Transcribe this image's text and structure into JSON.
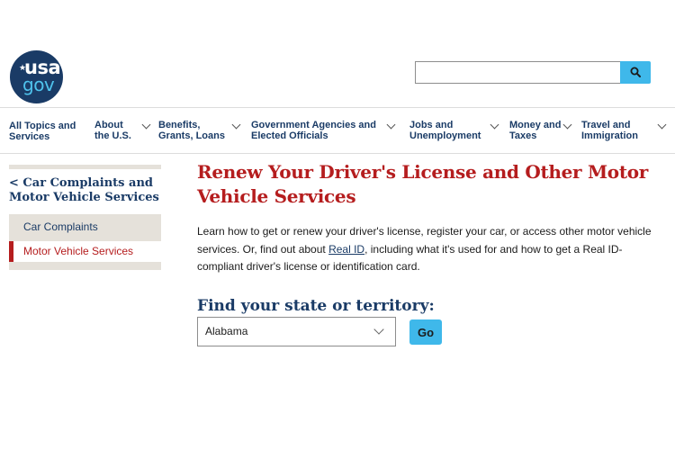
{
  "header": {
    "logo": {
      "line1": "usa",
      "line2": "gov",
      "star": "★"
    },
    "search": {
      "value": "",
      "placeholder": "",
      "button_icon": "search-icon"
    }
  },
  "nav": {
    "items": [
      {
        "label": "All Topics and\nServices",
        "has_dropdown": false
      },
      {
        "label": "About\nthe U.S.",
        "has_dropdown": true
      },
      {
        "label": "Benefits,\nGrants, Loans",
        "has_dropdown": true
      },
      {
        "label": "Government Agencies and\nElected Officials",
        "has_dropdown": true
      },
      {
        "label": "Jobs and\nUnemployment",
        "has_dropdown": true
      },
      {
        "label": "Money and\nTaxes",
        "has_dropdown": true
      },
      {
        "label": "Travel and\nImmigration",
        "has_dropdown": true
      }
    ]
  },
  "sidenav": {
    "parent": "< Car Complaints and Motor Vehicle Services",
    "items": [
      {
        "label": "Car Complaints",
        "active": false
      },
      {
        "label": "Motor Vehicle Services",
        "active": true
      }
    ]
  },
  "main": {
    "title": "Renew Your Driver's License and Other Motor Vehicle Services",
    "intro_before": "Learn how to get or renew your driver's license, register your car, or access other motor vehicle services. Or, find out about ",
    "intro_link": "Real ID",
    "intro_after": ", including what it's used for and how to get a Real ID-compliant driver's license or identification card.",
    "finder_heading": "Find your state or territory:",
    "state_select": {
      "selected": "Alabama"
    },
    "go_label": "Go"
  },
  "colors": {
    "brand_navy": "#1a3b66",
    "accent_red": "#b51d1e",
    "button_cyan": "#3fb8ea",
    "sidenav_bg": "#e5e1da"
  }
}
